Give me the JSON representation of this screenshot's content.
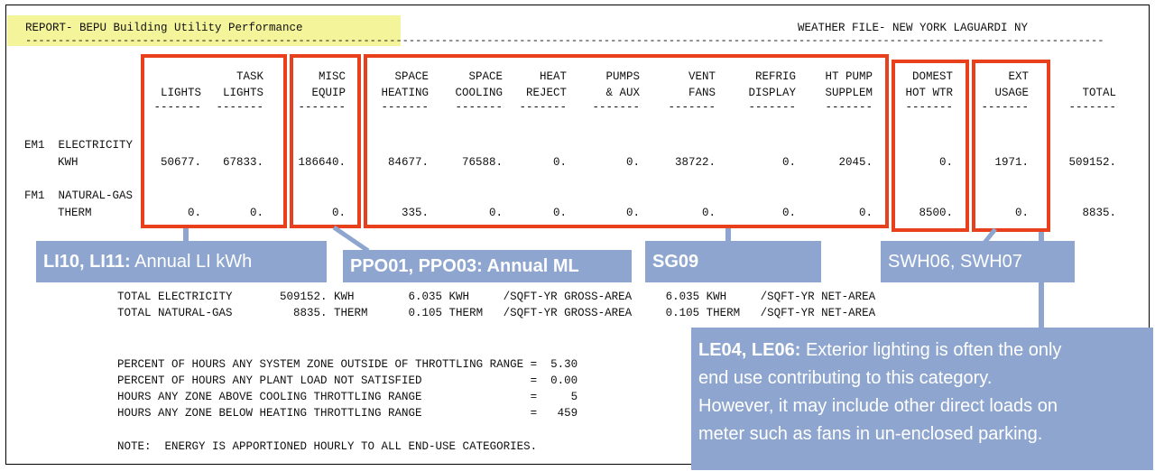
{
  "report": {
    "title": "REPORT- BEPU Building Utility Performance",
    "weather": "WEATHER FILE- NEW YORK LAGUARDI NY"
  },
  "columns": [
    {
      "l1": "",
      "l2": "LIGHTS"
    },
    {
      "l1": "TASK",
      "l2": "LIGHTS"
    },
    {
      "l1": "MISC",
      "l2": "EQUIP"
    },
    {
      "l1": "SPACE",
      "l2": "HEATING"
    },
    {
      "l1": "SPACE",
      "l2": "COOLING"
    },
    {
      "l1": "HEAT",
      "l2": "REJECT"
    },
    {
      "l1": "PUMPS",
      "l2": "& AUX"
    },
    {
      "l1": "VENT",
      "l2": "FANS"
    },
    {
      "l1": "REFRIG",
      "l2": "DISPLAY"
    },
    {
      "l1": "HT PUMP",
      "l2": "SUPPLEM"
    },
    {
      "l1": "DOMEST",
      "l2": "HOT WTR"
    },
    {
      "l1": "EXT",
      "l2": "USAGE"
    },
    {
      "l1": "",
      "l2": "TOTAL"
    }
  ],
  "meters": [
    {
      "name": "EM1  ELECTRICITY",
      "unit": "KWH",
      "values": [
        "50677.",
        "67833.",
        "186640.",
        "84677.",
        "76588.",
        "0.",
        "0.",
        "38722.",
        "0.",
        "2045.",
        "0.",
        "1971.",
        "509152."
      ]
    },
    {
      "name": "FM1  NATURAL-GAS",
      "unit": "THERM",
      "values": [
        "0.",
        "0.",
        "0.",
        "335.",
        "0.",
        "0.",
        "0.",
        "0.",
        "0.",
        "0.",
        "8500.",
        "0.",
        "8835."
      ]
    }
  ],
  "totals": [
    "TOTAL ELECTRICITY       509152. KWH        6.035 KWH     /SQFT-YR GROSS-AREA     6.035 KWH     /SQFT-YR NET-AREA",
    "TOTAL NATURAL-GAS         8835. THERM      0.105 THERM   /SQFT-YR GROSS-AREA     0.105 THERM   /SQFT-YR NET-AREA"
  ],
  "stats": [
    "PERCENT OF HOURS ANY SYSTEM ZONE OUTSIDE OF THROTTLING RANGE =  5.30",
    "PERCENT OF HOURS ANY PLANT LOAD NOT SATISFIED                =  0.00",
    "HOURS ANY ZONE ABOVE COOLING THROTTLING RANGE                =     5",
    "HOURS ANY ZONE BELOW HEATING THROTTLING RANGE                =   459"
  ],
  "note": "NOTE:  ENERGY IS APPORTIONED HOURLY TO ALL END-USE CATEGORIES.",
  "callouts": {
    "lights": {
      "code": "LI10, LI11:",
      "text": " Annual LI kWh"
    },
    "misc": {
      "code": "PPO01, PPO03: Annual ML",
      "text": ""
    },
    "hvac": {
      "code": "SG09",
      "text": ""
    },
    "dhw": {
      "code": "",
      "text": "SWH06, SWH07"
    },
    "ext": {
      "code": "LE04, LE06:",
      "line1": " Exterior lighting is often the only",
      "line2": "end use contributing to this category.",
      "line3": "However, it may include other direct loads on",
      "line4": "meter such as fans in un-enclosed parking."
    }
  },
  "colors": {
    "box": "#e8401c",
    "callout": "#8ea6cf",
    "highlight": "#f4f49a"
  }
}
